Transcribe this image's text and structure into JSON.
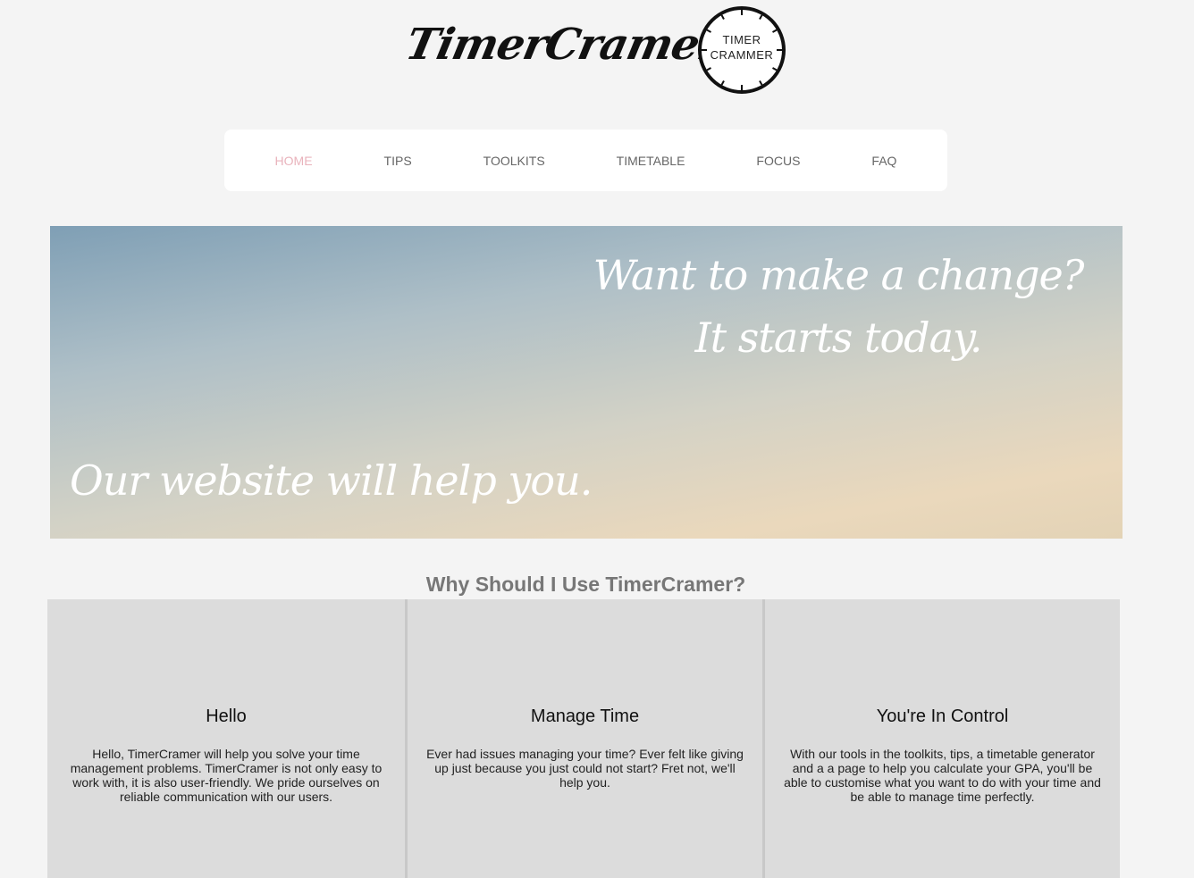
{
  "header": {
    "brand_name": "TimerCramer",
    "logo_line_1": "TIMER",
    "logo_line_2": "CRAMMER"
  },
  "nav": {
    "items": [
      {
        "label": "HOME",
        "active": true
      },
      {
        "label": "TIPS",
        "active": false
      },
      {
        "label": "TOOLKITS",
        "active": false
      },
      {
        "label": "TIMETABLE",
        "active": false
      },
      {
        "label": "FOCUS",
        "active": false
      },
      {
        "label": "FAQ",
        "active": false
      }
    ],
    "active_color": "#e9b3bc"
  },
  "hero": {
    "headline_line_1": "Want to make a change?",
    "headline_line_2": "It starts today.",
    "subline": "Our website will help you."
  },
  "section": {
    "title": "Why Should I Use TimerCramer?"
  },
  "features": [
    {
      "title": "Hello",
      "body": "Hello, TimerCramer will help you solve your time management problems. TimerCramer is not only easy to work with, it is also user-friendly. We pride ourselves on reliable communication with our users."
    },
    {
      "title": "Manage Time",
      "body": "Ever had issues managing your time? Ever felt like giving up just because you just could not start? Fret not, we'll help you."
    },
    {
      "title": "You're In Control",
      "body": "With our tools in the toolkits, tips, a timetable generator and a a page to help you calculate your GPA, you'll be able to customise what you want to do with your time and be able to manage time perfectly."
    }
  ]
}
